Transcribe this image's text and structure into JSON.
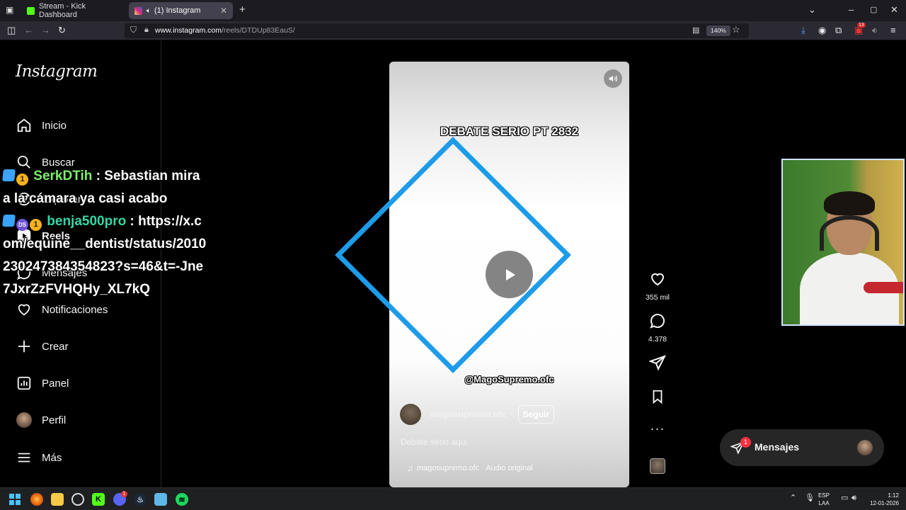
{
  "browser": {
    "tabs": [
      {
        "label": "Stream - Kick Dashboard",
        "active": false,
        "favicon_color": "#53fc18"
      },
      {
        "label": "(1) Instagram",
        "active": true,
        "favicon_color": "#d62976"
      }
    ],
    "new_tab": "+",
    "url_host": "www.instagram.com",
    "url_path": "/reels/DTDUp83EauS/",
    "zoom": "140%",
    "notification_count": "13"
  },
  "instagram": {
    "logo": "Instagram",
    "nav": [
      {
        "label": "Inicio",
        "icon": "home-icon"
      },
      {
        "label": "Buscar",
        "icon": "search-icon"
      },
      {
        "label": "Explorar",
        "icon": "compass-icon"
      },
      {
        "label": "Reels",
        "icon": "reels-icon"
      },
      {
        "label": "Mensajes",
        "icon": "messenger-icon"
      },
      {
        "label": "Notificaciones",
        "icon": "heart-icon"
      },
      {
        "label": "Crear",
        "icon": "plus-icon"
      },
      {
        "label": "Panel",
        "icon": "dashboard-icon"
      },
      {
        "label": "Perfil",
        "icon": "avatar-icon"
      },
      {
        "label": "Más",
        "icon": "menu-icon"
      }
    ],
    "reel": {
      "title": "DEBATE SERIO PT 2832",
      "watermark": "@MagoSupremo.ofc",
      "author": "magosupremo.ofc",
      "separator": "•",
      "follow": "Seguir",
      "caption": "Debate sério aqui",
      "caption_more": "... más",
      "audio": "magosupremo.ofc · Audio original"
    },
    "actions": {
      "likes": "355 mil",
      "comments": "4.378"
    },
    "messages": {
      "label": "Mensajes",
      "badge": "1"
    }
  },
  "overlay": {
    "diamond_color": "#1e9be9",
    "chat": [
      {
        "user": "SerkDTih",
        "sep": " : ",
        "text": "Sebastian mira a la cámara ya casi acabo",
        "badges": [
          "1"
        ]
      },
      {
        "user": "benja500pro",
        "sep": " :",
        "text": "https://x.com/equine__dentist/status/2010230247384354823?s=46&t=-Jne7JxrZzFVHQHy_XL7kQ",
        "badges": [
          "DS",
          "1"
        ]
      }
    ]
  },
  "taskbar": {
    "lang_top": "ESP",
    "lang_bottom": "LAA",
    "time": "1:12",
    "date": "12-01-2026",
    "discord_badge": "1"
  }
}
